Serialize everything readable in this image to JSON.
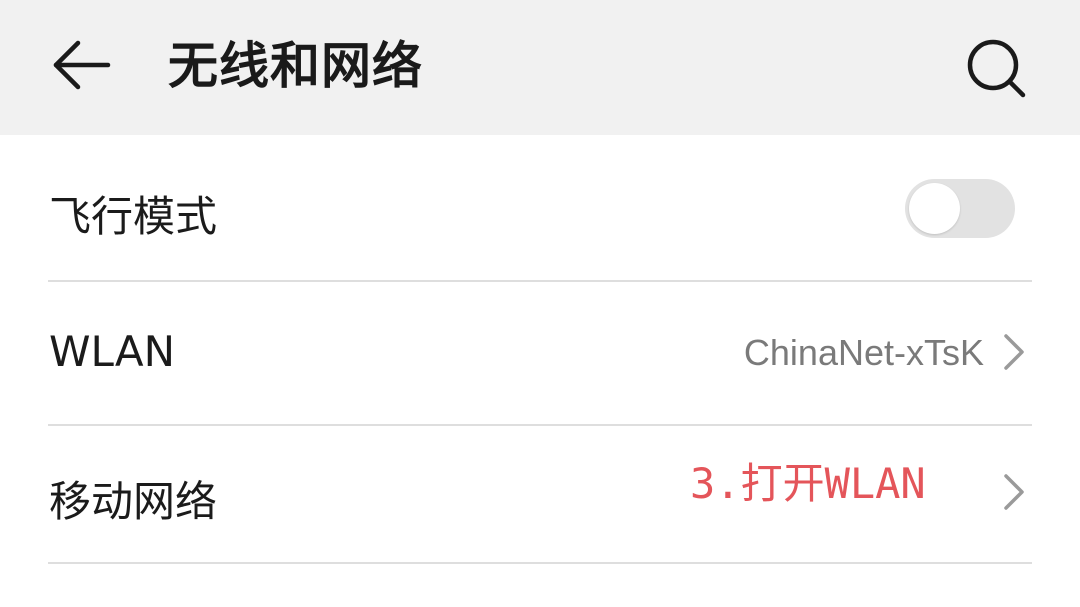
{
  "header": {
    "title": "无线和网络",
    "back_icon": "arrow-left-icon",
    "search_icon": "search-icon"
  },
  "settings": [
    {
      "label": "飞行模式",
      "control": "toggle",
      "toggle_on": false
    },
    {
      "label": "WLAN",
      "value": "ChinaNet-xTsK",
      "control": "chevron-right-icon"
    },
    {
      "label": "移动网络",
      "control": "chevron-right-icon"
    }
  ],
  "annotation": {
    "text": "3.打开WLAN",
    "color": "#e4555a"
  },
  "colors": {
    "header_bg": "#f1f1f1",
    "divider": "#dedede",
    "toggle_off_track": "#e2e2e2"
  }
}
